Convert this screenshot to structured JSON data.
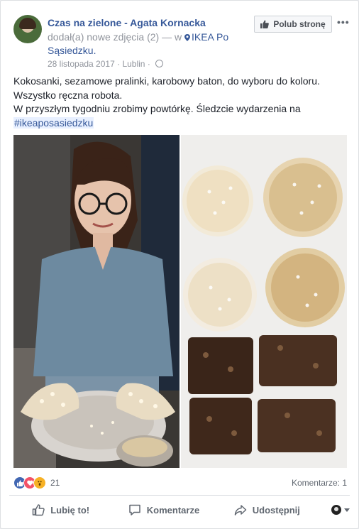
{
  "post": {
    "author": "Czas na zielone - Agata Kornacka",
    "action": "dodał(a) nowe zdjęcia (2) — w",
    "place": "IKEA Po Sąsiedzku.",
    "date": "28 listopada 2017",
    "separator": "·",
    "location": "Lublin",
    "like_page_label": "Polub stronę",
    "more_label": "•••",
    "text_lines": [
      "Kokosanki, sezamowe pralinki, karobowy baton, do wyboru do koloru.",
      "Wszystko ręczna robota.",
      "W przyszłym tygodniu zrobimy powtórkę. Śledzcie wydarzenia na"
    ],
    "hashtag": "#ikeaposasiedzku"
  },
  "stats": {
    "reaction_count": "21",
    "comments": "Komentarze: 1",
    "reactions": [
      "like",
      "love",
      "wow"
    ]
  },
  "actions": {
    "like": "Lubię to!",
    "comment": "Komentarze",
    "share": "Udostępnij"
  },
  "colors": {
    "link_blue": "#365899",
    "meta_gray": "#90949c",
    "action_gray": "#606770",
    "like_blue": "#4267b2",
    "love_red": "#f25268",
    "wow_yellow": "#f7b125"
  },
  "icons": {
    "avatar": "avatar",
    "pin": "location-pin-icon",
    "globe": "globe-icon",
    "thumb": "thumbs-up-icon",
    "comment": "comment-icon",
    "share": "share-icon"
  }
}
